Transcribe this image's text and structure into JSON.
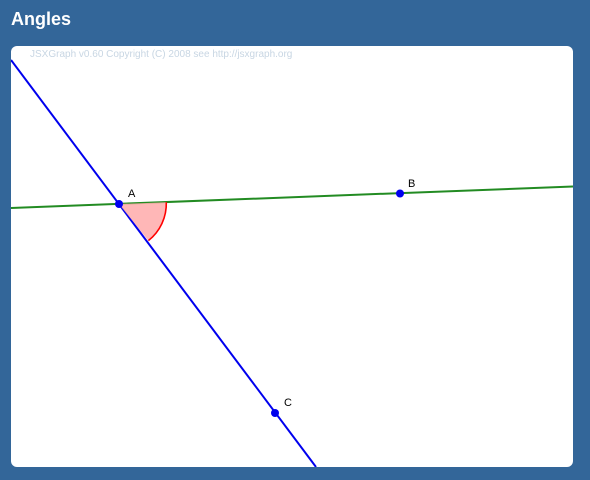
{
  "header": {
    "title": "Angles"
  },
  "board": {
    "copyright": "JSXGraph v0.60 Copyright (C) 2008 see http://jsxgraph.org"
  },
  "points": [
    {
      "name": "A",
      "color": "#0000ee"
    },
    {
      "name": "B",
      "color": "#0000ee"
    },
    {
      "name": "C",
      "color": "#0000ee"
    }
  ],
  "lines": [
    {
      "through": [
        "A",
        "B"
      ],
      "color": "#228b22"
    },
    {
      "through": [
        "A",
        "C"
      ],
      "color": "#0000ee"
    }
  ],
  "angle": {
    "vertex": "A",
    "between": [
      "B",
      "C"
    ],
    "fill_color": "#ffaaaa",
    "stroke_color": "#ff0000"
  }
}
